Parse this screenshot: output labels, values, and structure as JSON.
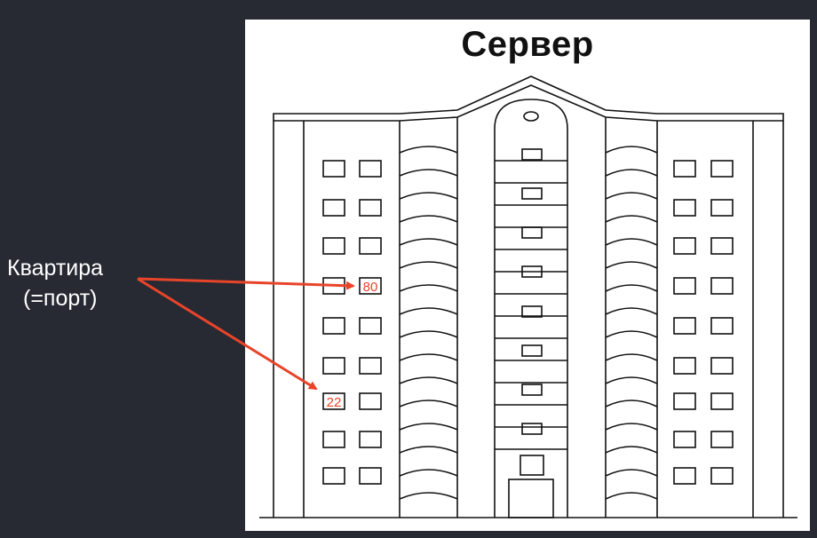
{
  "title": "Сервер",
  "label": {
    "line1": "Квартира",
    "line2": "(=порт)"
  },
  "ports": [
    "80",
    "22"
  ],
  "colors": {
    "background": "#272a33",
    "panel": "#ffffff",
    "accent": "#e8442a",
    "ink": "#111111"
  }
}
